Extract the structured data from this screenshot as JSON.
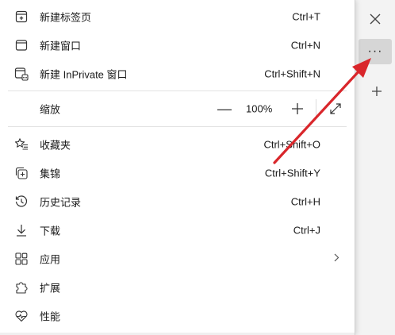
{
  "browser": {
    "close_icon": "close-icon",
    "more_icon": "more-horizontal-icon",
    "more_glyph": "···",
    "new_tab_icon": "plus-icon"
  },
  "menu": {
    "items": [
      {
        "label": "新建标签页",
        "shortcut": "Ctrl+T",
        "icon": "new-tab-icon"
      },
      {
        "label": "新建窗口",
        "shortcut": "Ctrl+N",
        "icon": "window-icon"
      },
      {
        "label": "新建 InPrivate 窗口",
        "shortcut": "Ctrl+Shift+N",
        "icon": "inprivate-icon"
      }
    ],
    "zoom": {
      "label": "缩放",
      "minus": "—",
      "value": "100%",
      "plus_icon": "plus-icon",
      "fullscreen_icon": "fullscreen-icon"
    },
    "items2": [
      {
        "label": "收藏夹",
        "shortcut": "Ctrl+Shift+O",
        "icon": "favorites-icon"
      },
      {
        "label": "集锦",
        "shortcut": "Ctrl+Shift+Y",
        "icon": "collections-icon"
      },
      {
        "label": "历史记录",
        "shortcut": "Ctrl+H",
        "icon": "history-icon"
      },
      {
        "label": "下载",
        "shortcut": "Ctrl+J",
        "icon": "download-icon"
      },
      {
        "label": "应用",
        "shortcut": "",
        "icon": "apps-icon",
        "has_submenu": true
      },
      {
        "label": "扩展",
        "shortcut": "",
        "icon": "extensions-icon"
      },
      {
        "label": "性能",
        "shortcut": "",
        "icon": "performance-icon"
      }
    ]
  },
  "colors": {
    "annotation_arrow": "#d9262b",
    "menu_bg": "#ffffff",
    "highlight_button": "#d6d6d6"
  }
}
